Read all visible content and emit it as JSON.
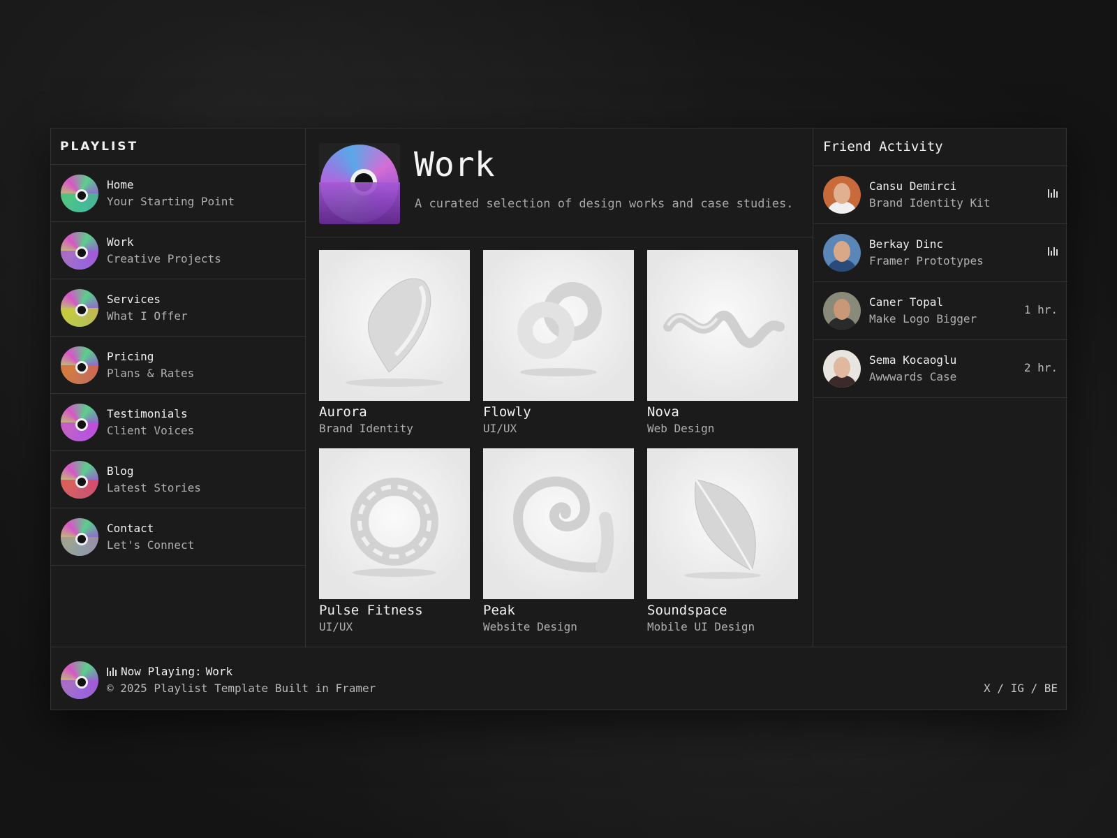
{
  "brand": "PLAYLIST",
  "nav": [
    {
      "title": "Home",
      "sub": "Your Starting Point",
      "tint": "#3fbf8a"
    },
    {
      "title": "Work",
      "sub": "Creative Projects",
      "tint": "#a45ad6"
    },
    {
      "title": "Services",
      "sub": "What I Offer",
      "tint": "#c8c83a"
    },
    {
      "title": "Pricing",
      "sub": "Plans & Rates",
      "tint": "#d86a3a"
    },
    {
      "title": "Testimonials",
      "sub": "Client Voices",
      "tint": "#c84ad8"
    },
    {
      "title": "Blog",
      "sub": "Latest Stories",
      "tint": "#e04a5a"
    },
    {
      "title": "Contact",
      "sub": "Let's Connect",
      "tint": "#9a9a9a"
    }
  ],
  "header": {
    "title": "Work",
    "subtitle": "A curated selection of design works and case studies."
  },
  "projects": [
    {
      "title": "Aurora",
      "sub": "Brand Identity",
      "shape": "teardrop"
    },
    {
      "title": "Flowly",
      "sub": "UI/UX",
      "shape": "knot"
    },
    {
      "title": "Nova",
      "sub": "Web Design",
      "shape": "wave"
    },
    {
      "title": "Pulse Fitness",
      "sub": "UI/UX",
      "shape": "ring"
    },
    {
      "title": "Peak",
      "sub": "Website Design",
      "shape": "spiral"
    },
    {
      "title": "Soundspace",
      "sub": "Mobile UI Design",
      "shape": "leaf"
    }
  ],
  "friends": {
    "heading": "Friend Activity",
    "items": [
      {
        "name": "Cansu Demirci",
        "track": "Brand Identity Kit",
        "status": "playing-icon",
        "time": ""
      },
      {
        "name": "Berkay Dinc",
        "track": "Framer Prototypes",
        "status": "playing-icon",
        "time": ""
      },
      {
        "name": "Caner Topal",
        "track": "Make Logo Bigger",
        "status": "",
        "time": "1 hr."
      },
      {
        "name": "Sema Kocaoglu",
        "track": "Awwwards Case",
        "status": "",
        "time": "2 hr."
      }
    ]
  },
  "footer": {
    "now_playing_label": "Now Playing:",
    "now_playing_value": "Work",
    "copyright": "© 2025 Playlist Template Built in Framer",
    "socials": "X / IG / BE"
  }
}
